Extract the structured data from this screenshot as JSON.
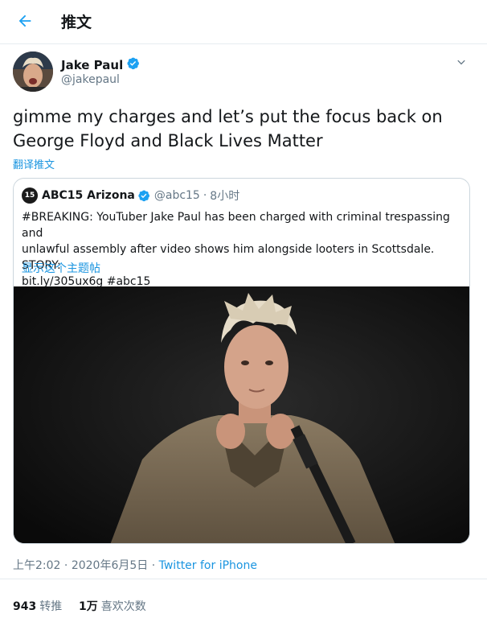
{
  "header": {
    "title": "推文",
    "back_icon": "arrow-left-icon"
  },
  "author": {
    "name": "Jake Paul",
    "handle": "@jakepaul",
    "verified_icon": "verified-badge-icon"
  },
  "tweet": {
    "text_line1": "gimme my charges and let’s put the focus back on",
    "text_line2": "George Floyd and Black Lives Matter",
    "translate_label": "翻译推文"
  },
  "quote": {
    "name": "ABC15 Arizona",
    "avatar_text": "15",
    "handle": "@abc15",
    "separator": "·",
    "time": "8小时",
    "body_line1": "#BREAKING: YouTuber Jake Paul has been charged with criminal trespassing and",
    "body_line2": "unlawful assembly after video shows him alongside looters in Scottsdale. STORY:",
    "body_line3": "bit.ly/305ux6g #abc15",
    "show_thread": "显示这个主题帖"
  },
  "meta": {
    "time": "上午2:02",
    "dot1": "·",
    "date": "2020年6月5日",
    "dot2": "·",
    "source": "Twitter for iPhone"
  },
  "stats": {
    "retweets_count": "943",
    "retweets_label": "转推",
    "likes_count": "1万",
    "likes_label": "喜欢次数"
  },
  "colors": {
    "accent": "#1da1f2",
    "link": "#1b95e0",
    "secondary_text": "#657786",
    "border": "#e6ecf0"
  }
}
